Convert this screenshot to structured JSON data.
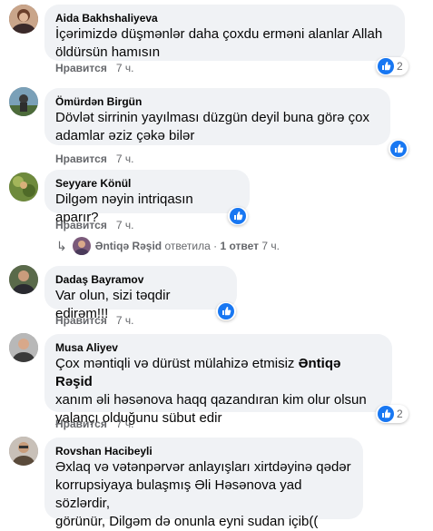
{
  "comments": [
    {
      "author": "Aida Bakhshaliyeva",
      "lines": [
        "İçərimizdə düşmənlər daha çoxdu erməni alanlar Allah",
        "öldürsün hamısın"
      ],
      "like_label": "Нравится",
      "time": "7 ч.",
      "reaction_count": "2"
    },
    {
      "author": "Ömürdən Birgün",
      "lines": [
        "Dövlət sirrinin yayılması düzgün deyil buna görə çox",
        "adamlar əziz çəkə bilər"
      ],
      "like_label": "Нравится",
      "time": "7 ч."
    },
    {
      "author": "Seyyare Könül",
      "lines": [
        "Dilgəm nəyin intriqasın aparır?"
      ],
      "like_label": "Нравится",
      "time": "7 ч.",
      "reply": {
        "author": "Əntiqə Rəşid",
        "action": "ответила",
        "separator": "·",
        "count": "1 ответ",
        "time": "7 ч."
      }
    },
    {
      "author": "Dadaş Bayramov",
      "lines": [
        "Var olun, sizi təqdir edirəm!!!"
      ],
      "like_label": "Нравится",
      "time": "7 ч."
    },
    {
      "author": "Musa Aliyev",
      "line1_prefix": "Çox məntiqli və dürüst mülahizə etmisiz ",
      "line1_mention": "Əntiqə Rəşid",
      "lines": [
        "xanım əli həsənova haqq qazandıran kim olur olsun",
        "yalançı olduğunu sübut edir"
      ],
      "like_label": "Нравится",
      "time": "7 ч.",
      "reaction_count": "2"
    },
    {
      "author": "Rovshan Hacibeyli",
      "lines": [
        "Əxlaq və vətənpərvər anlayışları xirtdəyinə qədər",
        "korrupsiyaya bulaşmış Əli Həsənova yad sözlərdir,",
        "görünür, Dilgəm də onunla eyni sudan içib(("
      ]
    }
  ],
  "colors": {
    "like_blue": "#1877f2",
    "meta_gray": "#65676b",
    "bubble": "#f0f2f5"
  },
  "icons": {
    "reaction": "like-thumb-icon",
    "reply": "reply-arrow-icon"
  }
}
